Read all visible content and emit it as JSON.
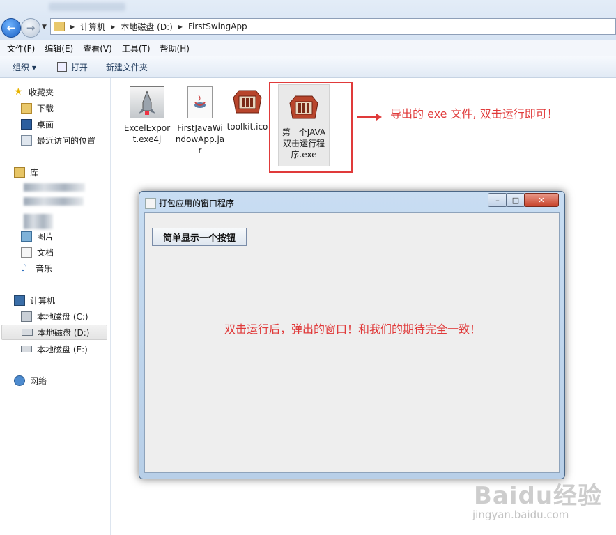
{
  "explorer": {
    "breadcrumb": [
      "计算机",
      "本地磁盘 (D:)",
      "FirstSwingApp"
    ],
    "menu": [
      "文件(F)",
      "编辑(E)",
      "查看(V)",
      "工具(T)",
      "帮助(H)"
    ],
    "toolbar": {
      "organize": "组织 ▾",
      "open": "打开",
      "new_folder": "新建文件夹"
    },
    "nav": {
      "favorites": "收藏夹",
      "downloads": "下载",
      "desktop": "桌面",
      "recent": "最近访问的位置",
      "library": "库",
      "pictures": "图片",
      "documents": "文档",
      "music": "音乐",
      "computer": "计算机",
      "drive_c": "本地磁盘 (C:)",
      "drive_d": "本地磁盘 (D:)",
      "drive_e": "本地磁盘 (E:)",
      "network": "网络"
    },
    "files": [
      {
        "name": "ExcelExport.exe4j",
        "icon": "rocket-icon"
      },
      {
        "name": "FirstJavaWindowApp.jar",
        "icon": "java-jar-icon"
      },
      {
        "name": "toolkit.ico",
        "icon": "toolkit-icon"
      },
      {
        "name": "第一个JAVA双击运行程序.exe",
        "icon": "toolkit-icon"
      }
    ]
  },
  "annotations": {
    "exe_note": "导出的 exe 文件, 双击运行即可！",
    "window_note": "双击运行后，弹出的窗口！和我们的期待完全一致！"
  },
  "java_window": {
    "title": "打包应用的窗口程序",
    "button_label": "简单显示一个按钮",
    "controls": {
      "minimize": "–",
      "maximize": "□",
      "close": "✕"
    }
  },
  "watermark": {
    "logo": "Baidu经验",
    "url": "jingyan.baidu.com"
  },
  "colors": {
    "annotation": "#e03a3a"
  }
}
